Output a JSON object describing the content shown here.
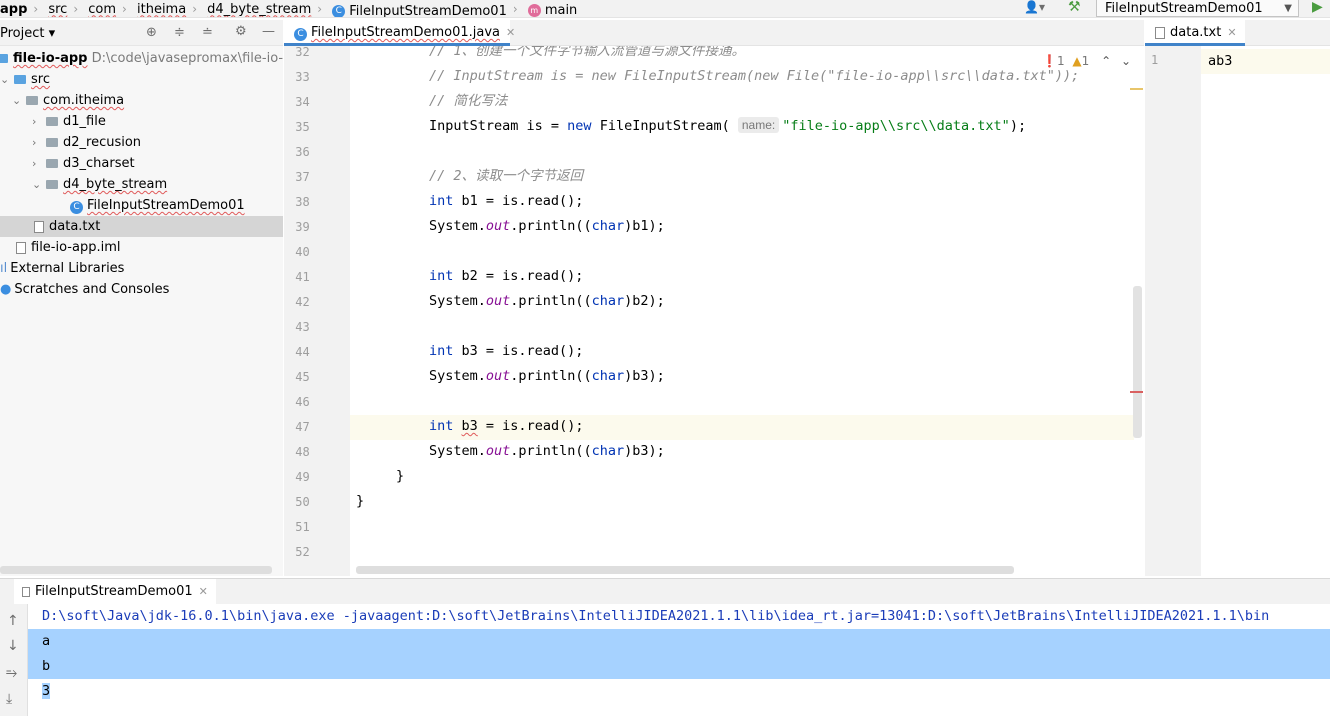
{
  "navbar": {
    "crumbs": [
      "app",
      "src",
      "com",
      "itheima",
      "d4_byte_stream",
      "FileInputStreamDemo01",
      "main"
    ],
    "run_config": "FileInputStreamDemo01"
  },
  "project": {
    "title": "Project",
    "root_name": "file-io-app",
    "root_path": "D:\\code\\javasepromax\\file-io-ap",
    "src": "src",
    "package": "com.itheima",
    "folders": [
      "d1_file",
      "d2_recusion",
      "d3_charset",
      "d4_byte_stream"
    ],
    "class_file": "FileInputStreamDemo01",
    "data_file": "data.txt",
    "iml": "file-io-app.iml",
    "ext_libs": "External Libraries",
    "scratches": "Scratches and Consoles"
  },
  "editor": {
    "tab": "FileInputStreamDemo01.java",
    "inspections": {
      "errors": "1",
      "warnings": "1"
    },
    "lines": [
      {
        "n": "32",
        "html": "<span class=\"cm\">// 1、创建一个文件字节输入流管道与源文件接通。</span>"
      },
      {
        "n": "33",
        "html": "<span class=\"cm\">// InputStream is = new FileInputStream(new File(\"file-io-app\\\\src\\\\data.txt\"));</span>"
      },
      {
        "n": "34",
        "html": "<span class=\"cm\">// 简化写法</span>"
      },
      {
        "n": "35",
        "html": "InputStream is = <span class=\"kw\">new</span> FileInputStream( <span class=\"hint\">name:</span><span class=\"st\">\"file-io-app\\\\src\\\\data.txt\"</span>);"
      },
      {
        "n": "36",
        "html": ""
      },
      {
        "n": "37",
        "html": "<span class=\"cm\">// 2、读取一个字节返回</span>"
      },
      {
        "n": "38",
        "html": "<span class=\"kw\">int</span> b1 = is.read();"
      },
      {
        "n": "39",
        "html": "System.<span class=\"fld\">out</span>.println((<span class=\"kw\">char</span>)b1);"
      },
      {
        "n": "40",
        "html": ""
      },
      {
        "n": "41",
        "html": "<span class=\"kw\">int</span> b2 = is.read();"
      },
      {
        "n": "42",
        "html": "System.<span class=\"fld\">out</span>.println((<span class=\"kw\">char</span>)b2);"
      },
      {
        "n": "43",
        "html": ""
      },
      {
        "n": "44",
        "html": "<span class=\"kw\">int</span> b3 = is.read();"
      },
      {
        "n": "45",
        "html": "System.<span class=\"fld\">out</span>.println((<span class=\"kw\">char</span>)b3);"
      },
      {
        "n": "46",
        "html": ""
      },
      {
        "n": "47",
        "html": "<span class=\"kw\">int</span> <span class=\"sq\">b3</span> = is.read();"
      },
      {
        "n": "48",
        "html": "System.<span class=\"fld\">out</span>.println((<span class=\"kw\">char</span>)b3);"
      },
      {
        "n": "49",
        "html": "}"
      },
      {
        "n": "50",
        "html": "}"
      },
      {
        "n": "51",
        "html": ""
      },
      {
        "n": "52",
        "html": ""
      }
    ]
  },
  "side_editor": {
    "tab": "data.txt",
    "line_no": "1",
    "content": "ab3"
  },
  "run": {
    "tab": "FileInputStreamDemo01",
    "command": "D:\\soft\\Java\\jdk-16.0.1\\bin\\java.exe -javaagent:D:\\soft\\JetBrains\\IntelliJIDEA2021.1.1\\lib\\idea_rt.jar=13041:D:\\soft\\JetBrains\\IntelliJIDEA2021.1.1\\bin",
    "output": [
      "a",
      "b",
      "3"
    ]
  },
  "colors": {
    "selection": "#a6d2ff",
    "caret_line": "#fcfaed",
    "keyword": "#0033b3",
    "string": "#067d17"
  }
}
